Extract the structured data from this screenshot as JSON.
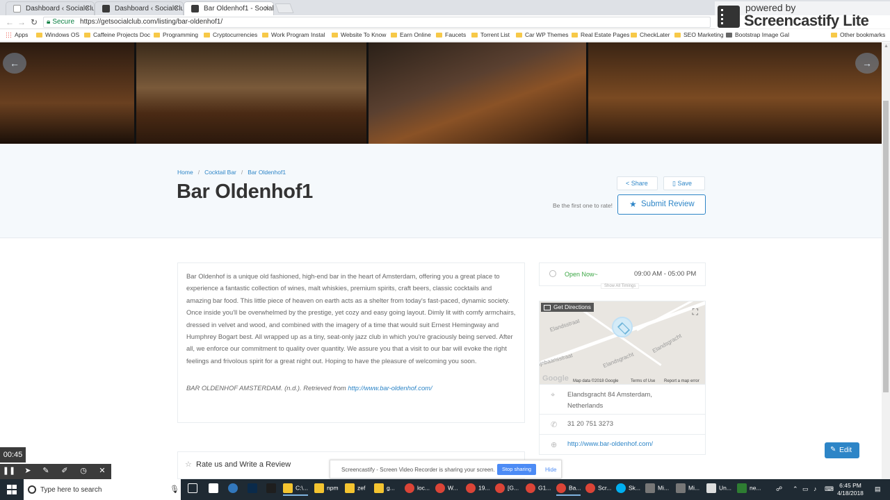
{
  "browser": {
    "tabs": [
      {
        "title": "Dashboard ‹ SocialClub",
        "close": "×"
      },
      {
        "title": "Dashboard ‹ SocialClub",
        "close": "×"
      },
      {
        "title": "Bar Oldenhof1 - SocialC",
        "close": "×"
      }
    ],
    "secure_label": "Secure",
    "url": "https://getsocialclub.com/listing/bar-oldenhof1/",
    "bookmarks": [
      "Apps",
      "Windows OS",
      "Caffeine Projects Doc",
      "Programming",
      "Cryptocurrencies",
      "Work Program Instal",
      "Website To Know",
      "Earn Online",
      "Faucets",
      "Torrent List",
      "Car WP Themes",
      "Real Estate Pages",
      "CheckLater",
      "SEO Marketing",
      "Bootstrap Image Gal"
    ],
    "other_bookmarks": "Other bookmarks"
  },
  "watermark": {
    "powered_by": "powered by",
    "name": "Screencastify Lite"
  },
  "listing": {
    "breadcrumbs": [
      "Home",
      "Cocktail Bar",
      "Bar Oldenhof1"
    ],
    "breadcrumb_sep": "/",
    "title": "Bar Oldenhof1",
    "share_label": "Share",
    "save_label": "Save",
    "first_rate": "Be the first one to rate!",
    "submit_review": "Submit Review",
    "description": "Bar Oldenhof is a unique old fashioned, high-end bar in the heart of Amsterdam, offering you a great place to experience a fantastic collection of wines, malt whiskies, premium spirits, craft beers, classic cocktails and amazing bar food. This little piece of heaven on earth acts as a shelter from today's fast-paced, dynamic society. Once inside you'll be overwhelmed by the prestige, yet cozy and easy going layout. Dimly lit with comfy armchairs, dressed in velvet and wood, and combined with the imagery of a time that would suit Ernest Hemingway and Humphrey Bogart best. All wrapped up as a tiny, seat-only jazz club in which you're graciously being served. After all, we enforce our commitment to quality over quantity. We assure you that a visit to our bar will evoke the right feelings and frivolous spirit for a great night out. Hoping to have the pleasure of welcoming you soon.",
    "citation_text": "BAR OLDENHOF AMSTERDAM. (n.d.). Retrieved from ",
    "citation_link": "http://www.bar-oldenhof.com/",
    "hours_status": "Open Now~",
    "hours_time": "09:00 AM - 05:00 PM",
    "show_all_timings": "Show All Timings",
    "map": {
      "directions": "Get Directions",
      "streets": [
        "Elandsstraat",
        "Elandsgracht",
        "Elandsgracht",
        "Lijnbaansstraat"
      ],
      "google": "Google",
      "map_data": "Map data ©2018 Google",
      "terms": "Terms of Use",
      "report": "Report a map error"
    },
    "address": "Elandsgracht 84 Amsterdam, Netherlands",
    "phone": "31 20 751 3273",
    "website": "http://www.bar-oldenhof.com/",
    "rate_label": "Rate us and Write a Review",
    "edit_label": "Edit"
  },
  "recorder": {
    "time": "00:45",
    "share_message": "Screencastify - Screen Video Recorder is sharing your screen.",
    "stop_label": "Stop sharing",
    "hide_label": "Hide"
  },
  "taskbar": {
    "search_placeholder": "Type here to search",
    "items": [
      "C:\\...",
      "npm",
      "zef",
      "g...",
      "loc...",
      "W...",
      "19...",
      "[G...",
      "G1...",
      "Ba...",
      "Scr...",
      "Sk...",
      "Mi...",
      "Mi...",
      "Un...",
      "ne..."
    ],
    "time": "6:45 PM",
    "date": "4/18/2018"
  },
  "colors": {
    "accent": "#2d85c7",
    "open": "#3aa643",
    "taskbar": "#1f2a33"
  }
}
